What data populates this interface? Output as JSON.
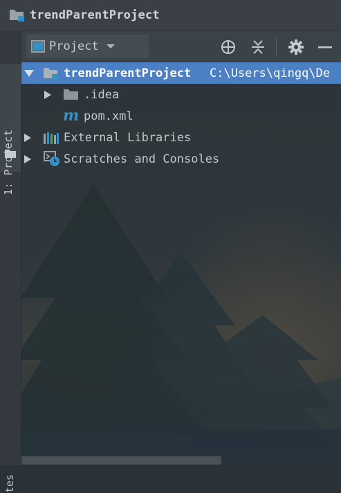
{
  "window": {
    "title": "trendParentProject"
  },
  "sidebar": {
    "project_tab_label": "1: Project",
    "bottom_tab_label": "tes"
  },
  "toolbar": {
    "view_selector_label": "Project",
    "buttons": [
      "locate-icon",
      "collapse-all-icon",
      "gear-icon",
      "minimize-icon"
    ]
  },
  "tree": {
    "root": {
      "label": "trendParentProject",
      "path": "C:\\Users\\qingq\\De"
    },
    "items": [
      {
        "label": ".idea",
        "icon": "folder-icon"
      },
      {
        "label": "pom.xml",
        "icon": "maven-icon"
      },
      {
        "label": "External Libraries",
        "icon": "library-icon"
      },
      {
        "label": "Scratches and Consoles",
        "icon": "scratches-icon"
      }
    ]
  },
  "colors": {
    "selection": "#4b80c4",
    "accent_blue": "#3592c4",
    "background": "#2b3237"
  }
}
